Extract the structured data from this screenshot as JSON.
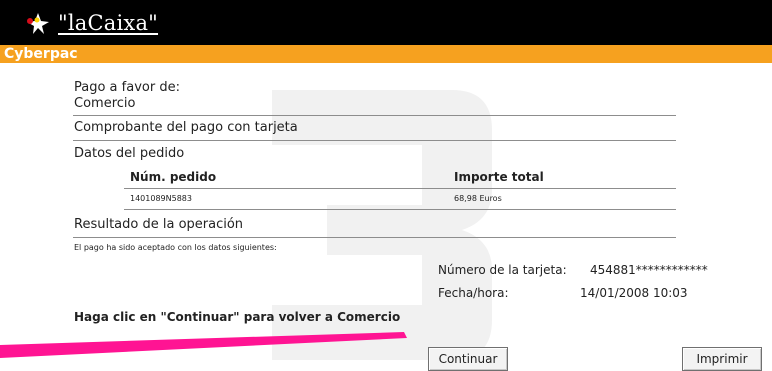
{
  "header": {
    "brand": "\"laCaixa\"",
    "section_title": "Cyberpac"
  },
  "payment": {
    "pay_to_label": "Pago a favor de:",
    "merchant": "Comercio",
    "receipt_title": "Comprobante del pago con tarjeta",
    "order_section": "Datos del pedido",
    "table": {
      "headers": [
        "Núm. pedido",
        "Importe total"
      ],
      "rows": [
        [
          "1401089N5883",
          "68,98 Euros"
        ]
      ]
    },
    "result_section": "Resultado de la operación",
    "result_text": "El pago ha sido aceptado con los datos siguientes:",
    "card_number_label": "Número de la tarjeta:",
    "card_number_value": "454881************",
    "datetime_label": "Fecha/hora:",
    "datetime_value": "14/01/2008  10:03",
    "continue_instruction": "Haga clic en \"Continuar\" para volver a Comercio"
  },
  "actions": {
    "continue_label": "Continuar",
    "print_label": "Imprimir"
  },
  "colors": {
    "header_bg": "#000000",
    "accent_orange": "#f6a11f",
    "pointer_magenta": "#ff1493"
  }
}
